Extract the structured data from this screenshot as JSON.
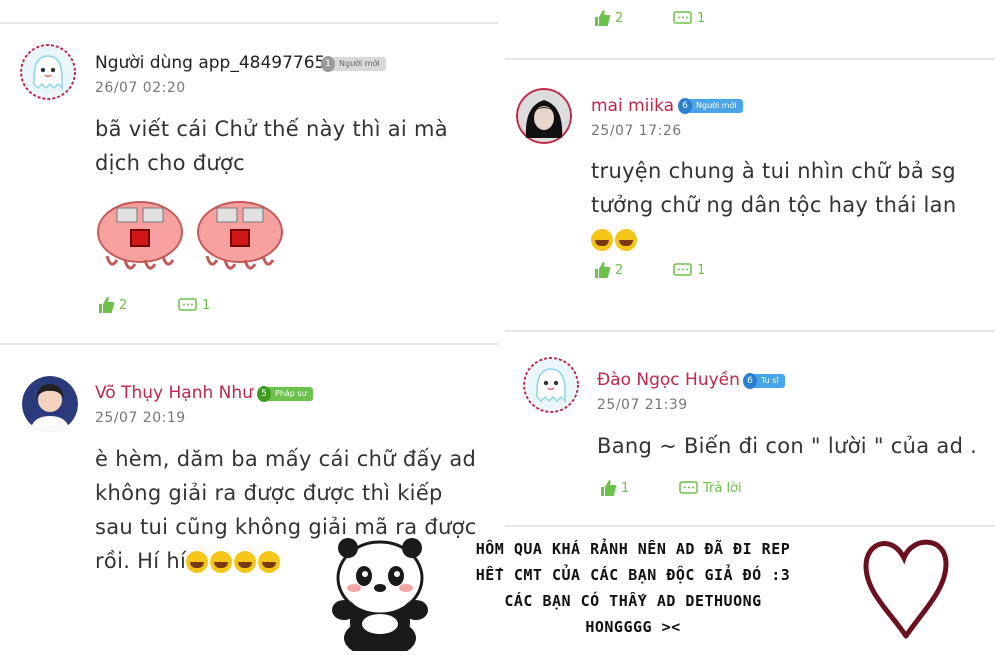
{
  "comments": [
    {
      "username": "Người dùng app_48497765",
      "level": "1",
      "rank": "Người mới",
      "time": "26/07 02:20",
      "text_lines": [
        "bã viết cái Chử thế này thì ai mà",
        "dịch cho được"
      ],
      "likes": "2",
      "replies": "1",
      "avatar": "ghost-avatar"
    },
    {
      "username": "Võ Thụy Hạnh Như",
      "level": "5",
      "rank": "Pháp sư",
      "time": "25/07 20:19",
      "text_lines": [
        "è hèm, dăm ba mấy cái chữ đấy ad",
        "không giải ra được được thì kiếp",
        "sau tui cũng không giải mã ra được",
        "rồi. Hí hí"
      ],
      "avatar": "photo-avatar"
    },
    {
      "top_likes": "2",
      "top_replies": "1"
    },
    {
      "username": "mai miika",
      "level": "6",
      "rank": "Người mới",
      "time": "25/07 17:26",
      "text_lines": [
        "truyện chung à tui nhìn chữ bả sg",
        "tưởng chữ ng dân tộc hay thái lan"
      ],
      "likes": "2",
      "replies": "1",
      "avatar": "photo-avatar"
    },
    {
      "username": "Đào Ngọc Huyền",
      "level": "6",
      "rank": "Tu sĩ",
      "time": "25/07 21:39",
      "text_lines": [
        "Bang ~ Biến đi con \" lười \" của ad ."
      ],
      "likes": "1",
      "reply_label": "Trả lời",
      "avatar": "ghost-avatar"
    }
  ],
  "caption_lines": [
    "HÔM QUA KHÁ RẢNH NÊN AD ĐÃ ĐI REP",
    "HẾT CMT CỦA CÁC BẠN ĐỘC GIẢ ĐÓ :3",
    "CÁC BẠN CÓ THẤY AD DETHUONG",
    "HONGGGG ><"
  ],
  "colors": {
    "accent_green": "#6cc24a",
    "name_red": "#c0264a",
    "heart": "#6b1020"
  }
}
